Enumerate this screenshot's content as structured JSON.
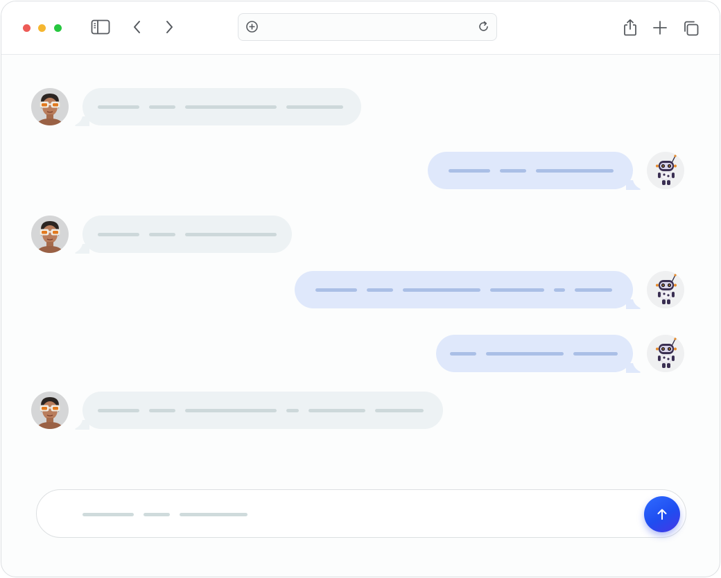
{
  "browser": {
    "traffic_lights": {
      "close": "#ed5b57",
      "minimize": "#f5b630",
      "maximize": "#27c73f"
    },
    "icons": {
      "sidebar": "sidebar-icon",
      "back": "chevron-left-icon",
      "forward": "chevron-right-icon",
      "address_prefix": "add-circle-icon",
      "reload": "reload-icon",
      "share": "share-icon",
      "new_tab": "plus-icon",
      "tabs": "tabs-icon"
    },
    "address_value": ""
  },
  "chat": {
    "colors": {
      "user_bubble": "#edf2f4",
      "bot_bubble": "#dfe8fb",
      "user_placeholder": "#cdd8da",
      "bot_placeholder": "#aabfe6"
    },
    "messages": [
      {
        "sender": "user",
        "avatar": "user-avatar",
        "text": ""
      },
      {
        "sender": "bot",
        "avatar": "robot-avatar",
        "text": ""
      },
      {
        "sender": "user",
        "avatar": "user-avatar",
        "text": ""
      },
      {
        "sender": "bot",
        "avatar": "robot-avatar",
        "text": ""
      },
      {
        "sender": "bot",
        "avatar": "robot-avatar",
        "text": ""
      },
      {
        "sender": "user",
        "avatar": "user-avatar",
        "text": ""
      }
    ]
  },
  "composer": {
    "input_value": "",
    "send_icon": "arrow-up-icon",
    "send_color": "#2553f5"
  }
}
